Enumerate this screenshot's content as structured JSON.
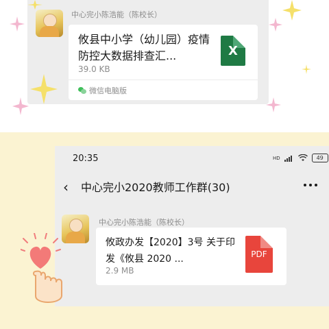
{
  "top_message": {
    "sender": "中心完小陈浩能（陈校长）",
    "file_title": "攸县中小学（幼儿园）疫情防控大数据排查汇...",
    "file_size": "39.0 KB",
    "source": "微信电脑版",
    "file_icon_label": "X"
  },
  "status_bar": {
    "time": "20:35",
    "signal_label": "HD",
    "battery": "49"
  },
  "header": {
    "back_icon": "‹",
    "title": "中心完小2020教师工作群(30)",
    "more_icon": "⋮"
  },
  "bottom_message": {
    "sender": "中心完小陈浩能（陈校长）",
    "file_title": "攸政办发【2020】3号 关于印发《攸县 2020 ...",
    "file_size": "2.9 MB",
    "file_icon_label": "PDF"
  },
  "colors": {
    "chat_bg": "#ededed",
    "excel_green": "#1f7a44",
    "pdf_red": "#e8453c",
    "wechat_green": "#3fbf5a",
    "frame_yellow": "#fbf3d2"
  }
}
